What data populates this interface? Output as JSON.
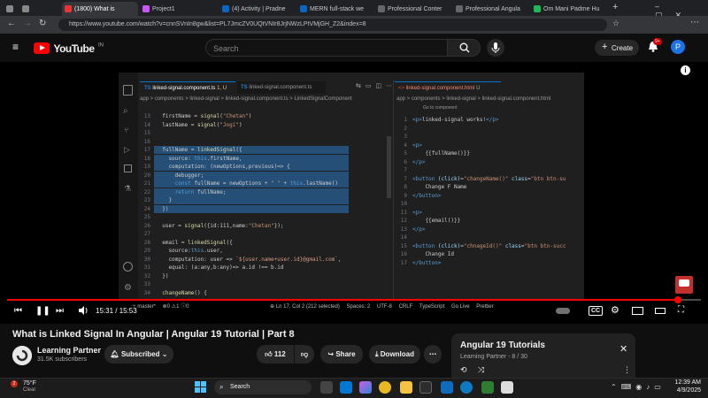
{
  "tabs": [
    {
      "title": "",
      "active": false
    },
    {
      "title": "",
      "active": false
    },
    {
      "title": "(1800) What is",
      "active": true
    },
    {
      "title": "Project1",
      "active": false
    },
    {
      "title": "(4) Activity | Pradne",
      "active": false
    },
    {
      "title": "MERN full-stack we",
      "active": false
    },
    {
      "title": "Professional Conter",
      "active": false
    },
    {
      "title": "Professional Angula",
      "active": false
    },
    {
      "title": "Om Mani Padme Hu",
      "active": false
    }
  ],
  "url": "https://www.youtube.com/watch?v=cnnSVnIn8gw&list=PL7JmcZV0UQtVNIr8JrjNWzLPtVMjGH_Z2&index=8",
  "youtube": {
    "logo": "YouTube",
    "region": "IN",
    "search_placeholder": "Search",
    "create_label": "Create",
    "notif_count": "9+",
    "avatar_letter": "P"
  },
  "vscode": {
    "tab_ts": "linked-signal.component.ts",
    "tab_ts_status": "1, U",
    "tab_ts2": "linked-signal.component.ts",
    "tab_html": "linked-signal.component.html",
    "tab_html_status": "U",
    "breadcrumb_left": "app > components > linked-signal > linked-signal.component.ts > LinkedSignalComponent",
    "breadcrumb_right": "app > components > linked-signal > linked-signal.component.html",
    "go_to_component": "Go to component",
    "ts_lines": [
      {
        "n": "13",
        "html": "  firstName = <span class=\"fn\">signal</span>(<span class=\"str\">\"Chetan\"</span>)"
      },
      {
        "n": "14",
        "html": "  lastName = <span class=\"fn\">signal</span>(<span class=\"str\">\"Jogi\"</span>)"
      },
      {
        "n": "15",
        "html": ""
      },
      {
        "n": "16",
        "html": ""
      },
      {
        "n": "17",
        "html": "  fullName = <span class=\"fn\">linkedSignal</span>({"
      },
      {
        "n": "18",
        "html": "    source: <span class=\"kw\">this</span>.firstName,"
      },
      {
        "n": "19",
        "html": "    computation: (newOptions,previous)=> {"
      },
      {
        "n": "20",
        "html": "      debugger;"
      },
      {
        "n": "21",
        "html": "      <span class=\"kw\">const</span> fullName = newOptions + <span class=\"str\">\" \"</span> + <span class=\"kw\">this</span>.lastName()"
      },
      {
        "n": "22",
        "html": "      <span class=\"kw\">return</span> fullName;"
      },
      {
        "n": "23",
        "html": "    }"
      },
      {
        "n": "24",
        "html": "  })"
      },
      {
        "n": "25",
        "html": ""
      },
      {
        "n": "26",
        "html": "  user = <span class=\"fn\">signal</span>({id:111,name:<span class=\"str\">\"Chetan\"</span>});"
      },
      {
        "n": "27",
        "html": ""
      },
      {
        "n": "28",
        "html": "  email = <span class=\"fn\">linkedSignal</span>({"
      },
      {
        "n": "29",
        "html": "    source:<span class=\"kw\">this</span>.user,"
      },
      {
        "n": "30",
        "html": "    computation: user => <span class=\"tpl\">`${user.name+user.id}@gmail.com`</span>,"
      },
      {
        "n": "31",
        "html": "    equal: (a:any,b:any)=> a.id !== b.id"
      },
      {
        "n": "32",
        "html": "  })"
      },
      {
        "n": "33",
        "html": ""
      },
      {
        "n": "34",
        "html": "  <span class=\"fn\">changeName</span>() {"
      }
    ],
    "html_lines": [
      {
        "n": "1",
        "html": "<span class=\"tag\">&lt;p&gt;</span>linked-signal works!<span class=\"tag\">&lt;/p&gt;</span>"
      },
      {
        "n": "2",
        "html": ""
      },
      {
        "n": "3",
        "html": ""
      },
      {
        "n": "4",
        "html": "<span class=\"tag\">&lt;p&gt;</span>"
      },
      {
        "n": "5",
        "html": "    {{fullName()}}"
      },
      {
        "n": "6",
        "html": "<span class=\"tag\">&lt;/p&gt;</span>"
      },
      {
        "n": "7",
        "html": ""
      },
      {
        "n": "7",
        "html": "<span class=\"tag\">&lt;button</span> <span class=\"var\">(click)</span>=<span class=\"str\">\"changeName()\"</span> <span class=\"var\">class</span>=<span class=\"str\">\"btn btn-su</span>"
      },
      {
        "n": "8",
        "html": "    Change F Name"
      },
      {
        "n": "9",
        "html": "<span class=\"tag\">&lt;/button&gt;</span>"
      },
      {
        "n": "10",
        "html": ""
      },
      {
        "n": "11",
        "html": "<span class=\"tag\">&lt;p&gt;</span>"
      },
      {
        "n": "12",
        "html": "    {{email()}}"
      },
      {
        "n": "13",
        "html": "<span class=\"tag\">&lt;/p&gt;</span>"
      },
      {
        "n": "14",
        "html": ""
      },
      {
        "n": "15",
        "html": "<span class=\"tag\">&lt;button</span> <span class=\"var\">(click)</span>=<span class=\"str\">\"chnageId()\"</span> <span class=\"var\">class</span>=<span class=\"str\">\"btn btn-succ</span>"
      },
      {
        "n": "16",
        "html": "    Change Id"
      },
      {
        "n": "17",
        "html": "<span class=\"tag\">&lt;/button&gt;</span>"
      }
    ],
    "status": {
      "branch": "master*",
      "errors": "0",
      "warnings": "1",
      "info": "0",
      "cursor": "Ln 17, Col 2 (212 selected)",
      "spaces": "Spaces: 2",
      "encoding": "UTF-8",
      "eol": "CRLF",
      "lang": "TypeScript",
      "golive": "Go Live",
      "prettier": "Prettier"
    }
  },
  "player": {
    "time": "15:31 / 15:53",
    "progress_fraction": 0.967
  },
  "video": {
    "title": "What is Linked Signal In Angular | Angular 19 Tutorial | Part 8",
    "channel": "Learning Partner",
    "subscribers": "31.5K subscribers",
    "subscribed_label": "Subscribed",
    "likes": "112",
    "share_label": "Share",
    "download_label": "Download"
  },
  "playlist": {
    "title": "Angular 19 Tutorials",
    "subtitle": "Learning Partner - 8 / 30"
  },
  "taskbar": {
    "weather_temp": "75°F",
    "weather_desc": "Clear",
    "search_label": "Search",
    "time": "12:39 AM",
    "date": "4/9/2025",
    "badge_count": "2"
  },
  "colors": {
    "youtube_red": "#ff0000",
    "editor_bg": "#1f1f1f",
    "selection": "#264f78"
  }
}
